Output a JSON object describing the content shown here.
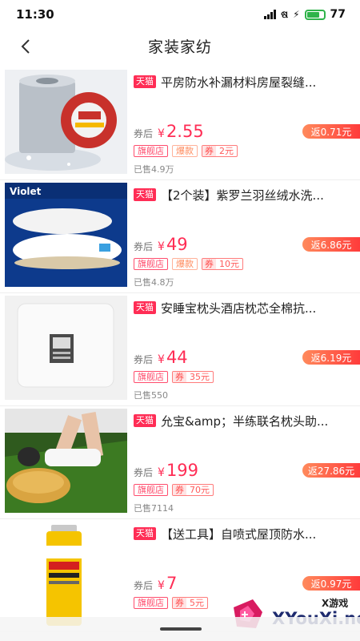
{
  "status": {
    "time": "11:30",
    "wifi": "ଷ",
    "bolt": "⚡",
    "battery": "77",
    "battery_level": 0.77
  },
  "header": {
    "title": "家装家纺"
  },
  "products": [
    {
      "badge": "天猫",
      "title": "平房防水补漏材料房屋裂缝...",
      "after_coupon": "券后",
      "currency": "¥",
      "price": "2.55",
      "rebate": "返0.71元",
      "store_tag": "旗舰店",
      "hot_tag": "爆款",
      "coupon_label": "券",
      "coupon_value": "2元",
      "sold": "已售4.9万"
    },
    {
      "badge": "天猫",
      "title": "【2个装】紫罗兰羽丝绒水洗...",
      "after_coupon": "券后",
      "currency": "¥",
      "price": "49",
      "rebate": "返6.86元",
      "store_tag": "旗舰店",
      "hot_tag": "爆款",
      "coupon_label": "券",
      "coupon_value": "10元",
      "sold": "已售4.8万",
      "image_text": "Violet"
    },
    {
      "badge": "天猫",
      "title": "安睡宝枕头酒店枕芯全棉抗...",
      "after_coupon": "券后",
      "currency": "¥",
      "price": "44",
      "rebate": "返6.19元",
      "store_tag": "旗舰店",
      "coupon_label": "券",
      "coupon_value": "35元",
      "sold": "已售550"
    },
    {
      "badge": "天猫",
      "title": "允宝&amp；半练联名枕头助...",
      "after_coupon": "券后",
      "currency": "¥",
      "price": "199",
      "rebate": "返27.86元",
      "store_tag": "旗舰店",
      "coupon_label": "券",
      "coupon_value": "70元",
      "sold": "已售7114"
    },
    {
      "badge": "天猫",
      "title": "【送工具】自喷式屋顶防水...",
      "after_coupon": "券后",
      "currency": "¥",
      "price": "7",
      "rebate": "返0.97元",
      "store_tag": "旗舰店",
      "coupon_label": "券",
      "coupon_value": "5元"
    }
  ],
  "watermark": {
    "top": "X游戏",
    "brand": "XYouXi.net"
  },
  "colors": {
    "accent": "#ff2d55",
    "rebate_start": "#ff8a5c",
    "rebate_end": "#ff3b3b",
    "battery": "#2fb34a"
  }
}
